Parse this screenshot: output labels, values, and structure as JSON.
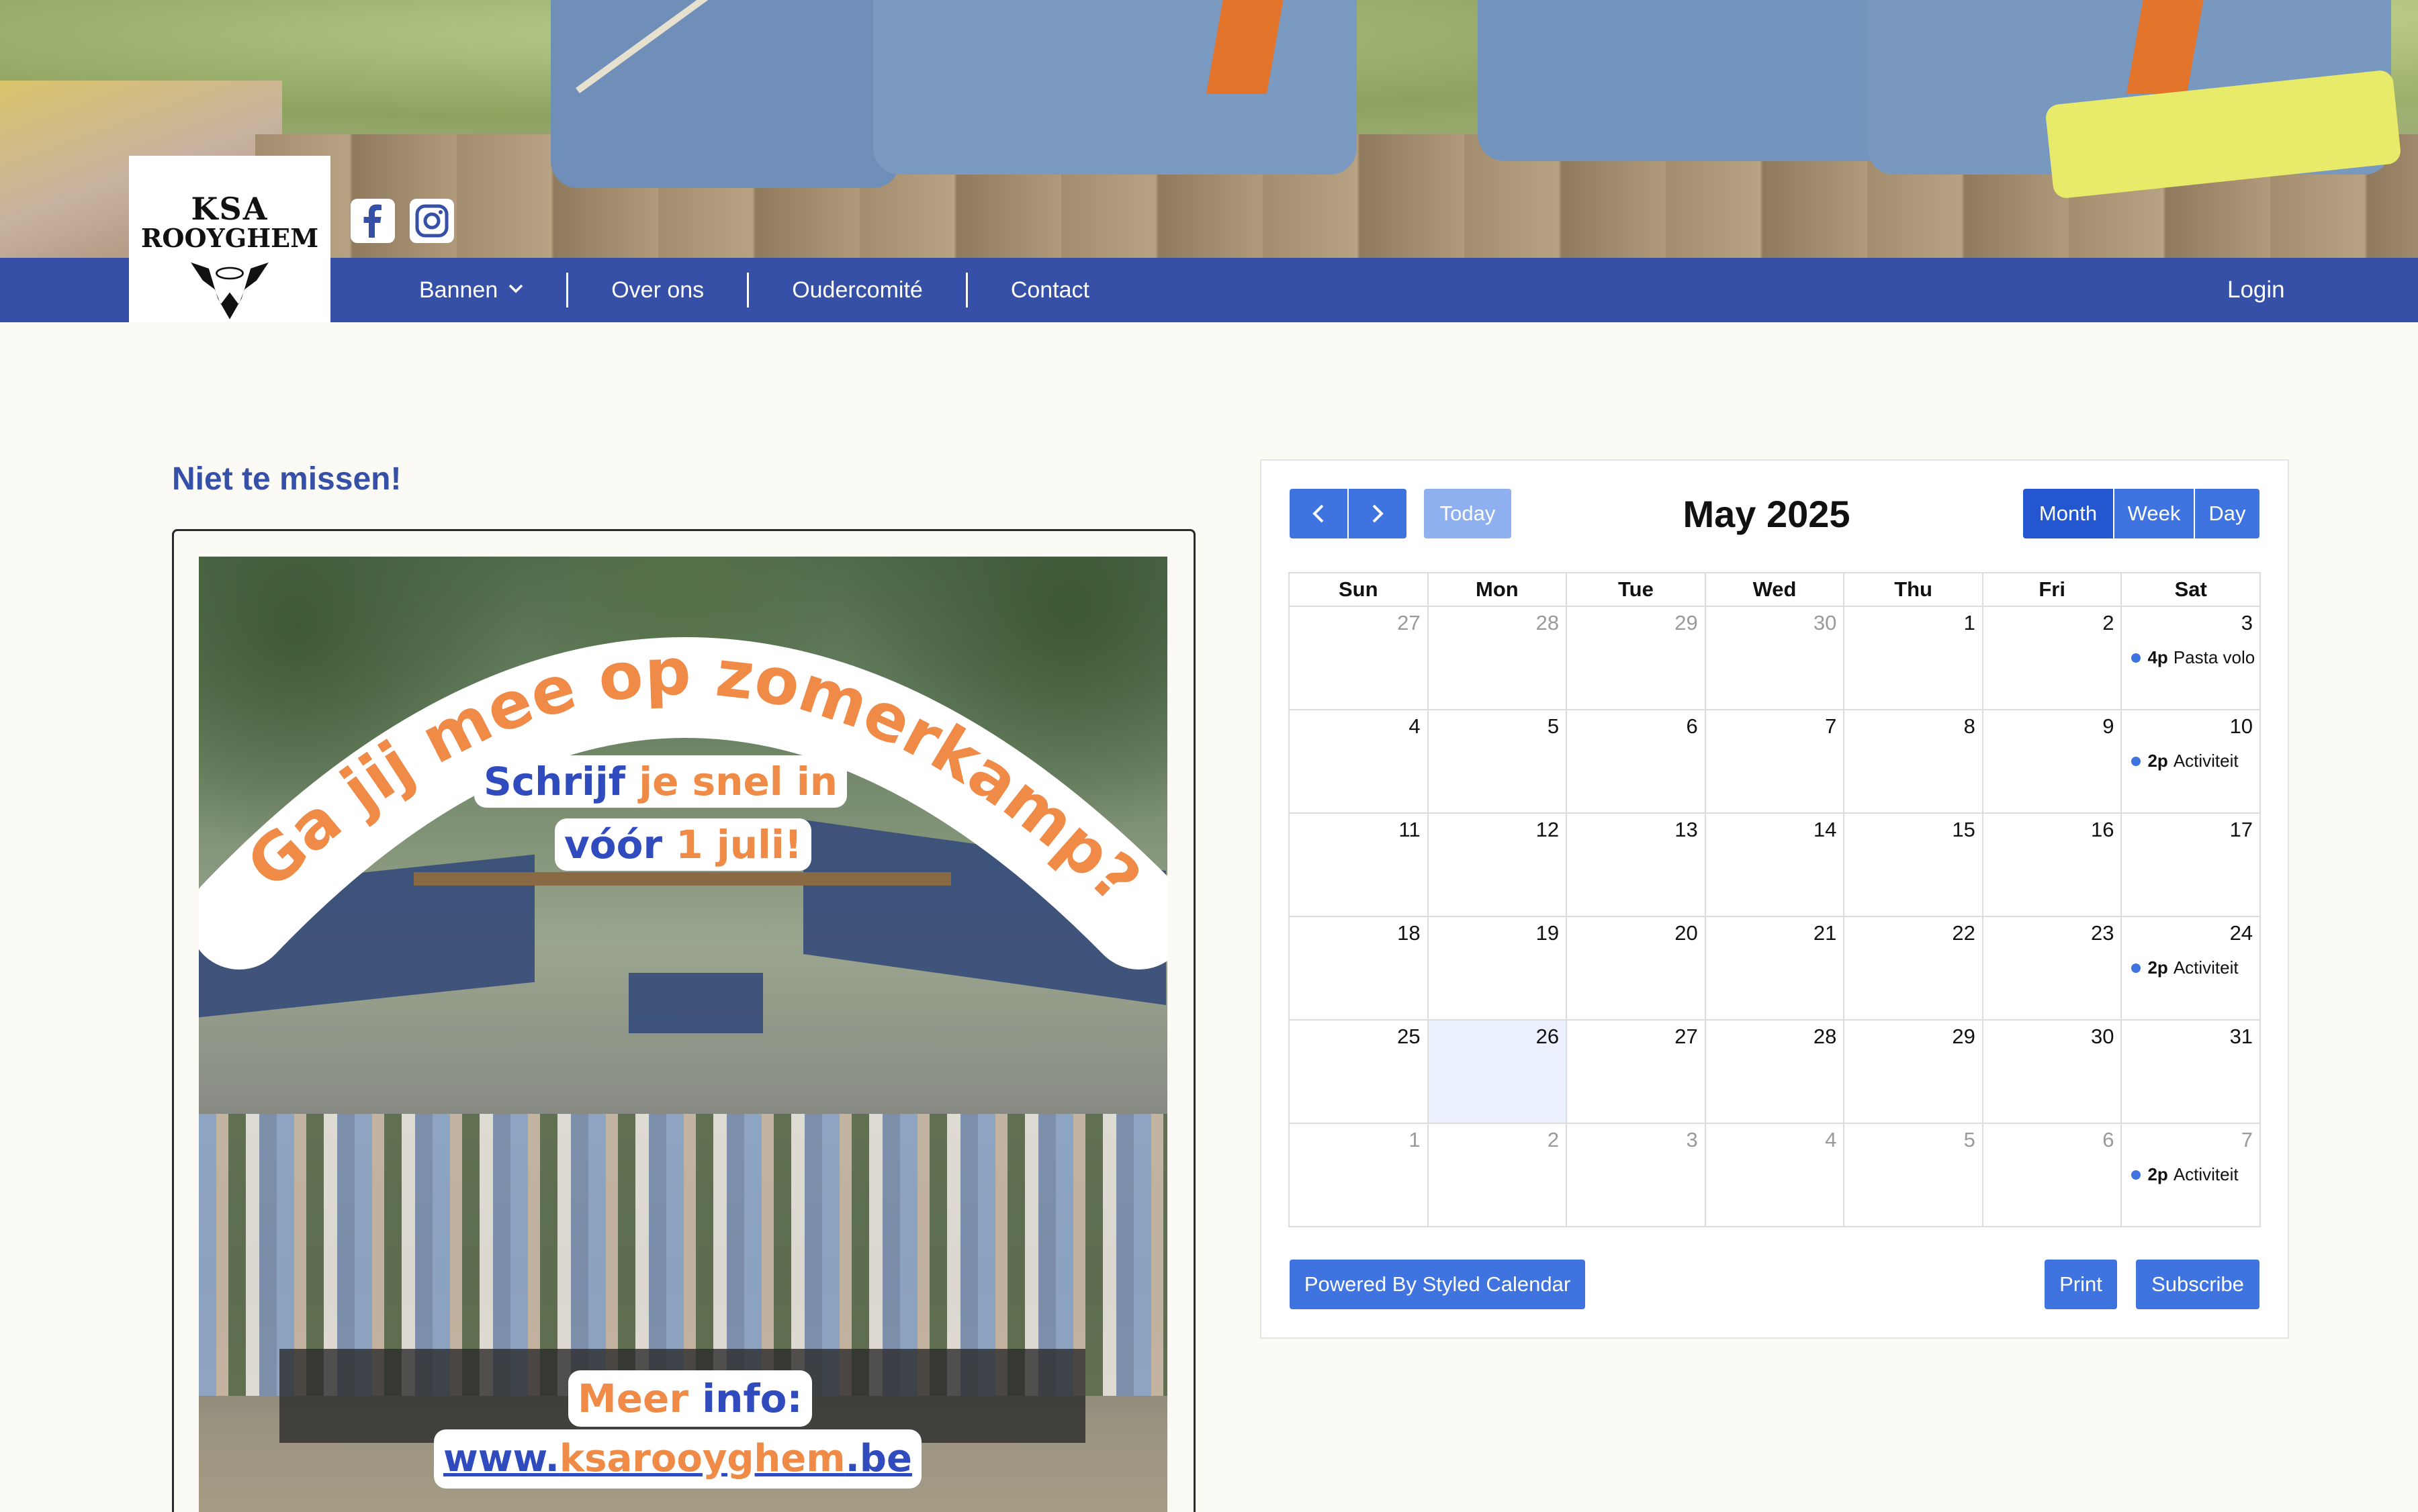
{
  "nav": {
    "items": [
      {
        "label": "Bannen",
        "has_dropdown": true
      },
      {
        "label": "Over ons"
      },
      {
        "label": "Oudercomité"
      },
      {
        "label": "Contact"
      }
    ],
    "login": "Login"
  },
  "logo": {
    "line1": "KSA",
    "line2": "ROOYGHEM"
  },
  "social": {
    "facebook_icon": "facebook-icon",
    "instagram_icon": "instagram-icon"
  },
  "section": {
    "title": "Niet te missen!"
  },
  "poster": {
    "arch_part1": "Ga jij mee op ",
    "arch_part2": "zomerkamp?",
    "line1_a": "Schrijf ",
    "line1_b": "je snel in",
    "line2_a": "vóór ",
    "line2_b": "1 juli!",
    "info_a": "Meer ",
    "info_b": "info:",
    "url_a": "www.",
    "url_b": "ksarooyghem",
    "url_c": ".be"
  },
  "calendar": {
    "prev_icon": "chevron-left-icon",
    "next_icon": "chevron-right-icon",
    "today_label": "Today",
    "title": "May 2025",
    "views": {
      "month": "Month",
      "week": "Week",
      "day": "Day"
    },
    "weekdays": [
      "Sun",
      "Mon",
      "Tue",
      "Wed",
      "Thu",
      "Fri",
      "Sat"
    ],
    "weeks": [
      [
        {
          "d": "27",
          "o": true
        },
        {
          "d": "28",
          "o": true
        },
        {
          "d": "29",
          "o": true
        },
        {
          "d": "30",
          "o": true
        },
        {
          "d": "1"
        },
        {
          "d": "2"
        },
        {
          "d": "3",
          "ev": {
            "time": "4p",
            "title": "Pasta volo"
          }
        }
      ],
      [
        {
          "d": "4"
        },
        {
          "d": "5"
        },
        {
          "d": "6"
        },
        {
          "d": "7"
        },
        {
          "d": "8"
        },
        {
          "d": "9"
        },
        {
          "d": "10",
          "ev": {
            "time": "2p",
            "title": "Activiteit"
          }
        }
      ],
      [
        {
          "d": "11"
        },
        {
          "d": "12"
        },
        {
          "d": "13"
        },
        {
          "d": "14"
        },
        {
          "d": "15"
        },
        {
          "d": "16"
        },
        {
          "d": "17"
        }
      ],
      [
        {
          "d": "18"
        },
        {
          "d": "19"
        },
        {
          "d": "20"
        },
        {
          "d": "21"
        },
        {
          "d": "22"
        },
        {
          "d": "23"
        },
        {
          "d": "24",
          "ev": {
            "time": "2p",
            "title": "Activiteit"
          }
        }
      ],
      [
        {
          "d": "25"
        },
        {
          "d": "26",
          "today": true
        },
        {
          "d": "27"
        },
        {
          "d": "28"
        },
        {
          "d": "29"
        },
        {
          "d": "30"
        },
        {
          "d": "31"
        }
      ],
      [
        {
          "d": "1",
          "o": true
        },
        {
          "d": "2",
          "o": true
        },
        {
          "d": "3",
          "o": true
        },
        {
          "d": "4",
          "o": true
        },
        {
          "d": "5",
          "o": true
        },
        {
          "d": "6",
          "o": true
        },
        {
          "d": "7",
          "o": true,
          "ev": {
            "time": "2p",
            "title": "Activiteit"
          }
        }
      ]
    ],
    "powered_label": "Powered By Styled Calendar",
    "print_label": "Print",
    "subscribe_label": "Subscribe"
  }
}
